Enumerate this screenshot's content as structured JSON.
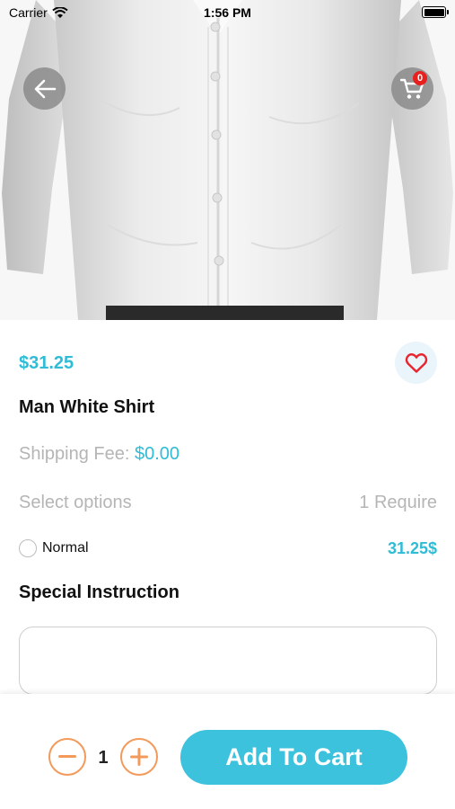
{
  "status_bar": {
    "carrier": "Carrier",
    "time": "1:56 PM",
    "wifi_icon": "wifi-icon",
    "battery_icon": "battery-icon"
  },
  "header": {
    "back_icon": "arrow-left-icon",
    "cart_icon": "shopping-cart-icon",
    "cart_count": "0"
  },
  "product": {
    "image": "white-dress-shirt-photo",
    "price": "$31.25",
    "name": "Man White Shirt",
    "favorite_icon": "heart-outline-icon",
    "shipping_label": "Shipping Fee:",
    "shipping_value": "$0.00"
  },
  "options": {
    "title": "Select options",
    "requirement": "1 Require",
    "items": [
      {
        "label": "Normal",
        "price": "31.25$",
        "selected": false
      }
    ]
  },
  "special_instruction": {
    "heading": "Special Instruction",
    "value": "",
    "placeholder": ""
  },
  "bottom_bar": {
    "minus_icon": "minus-circle-icon",
    "quantity": "1",
    "plus_icon": "plus-circle-icon",
    "add_to_cart_label": "Add To Cart"
  },
  "colors": {
    "accent": "#2fbcd6",
    "button": "#3cc2dc",
    "stepper": "#f39a5b",
    "badge": "#e61f1f",
    "favorite": "#e8252f"
  }
}
